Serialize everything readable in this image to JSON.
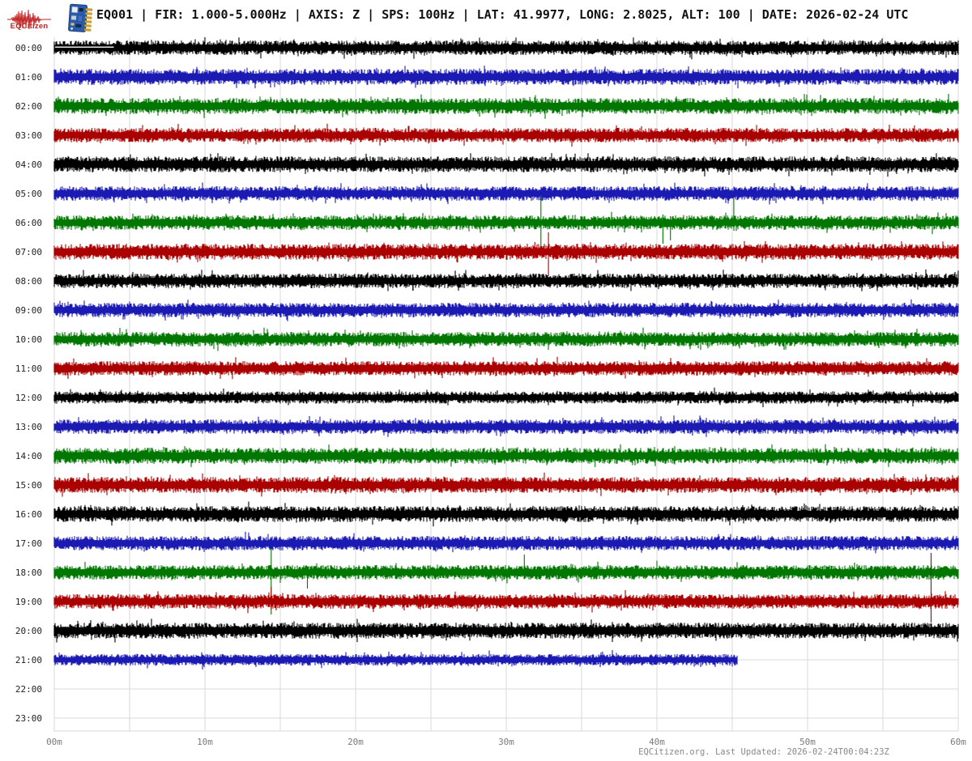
{
  "header": {
    "logo_text": "EQCitizen",
    "title": "EQ001 | FIR: 1.000-5.000Hz | AXIS: Z | SPS: 100Hz | LAT: 41.9977, LONG: 2.8025, ALT: 100 | DATE: 2026-02-24 UTC"
  },
  "colors": {
    "grid": "#d9d9d9",
    "hour_label": "#222222",
    "tick_label": "#7a7a7a",
    "footer_text": "#888888",
    "logo_red": "#c22222",
    "chip_blue": "#2b5cab",
    "chip_blue_dark": "#1c3f7a",
    "chip_gold": "#d9a520",
    "trace_black": "#000000",
    "trace_blue": "#1b1bb3",
    "trace_green": "#007700",
    "trace_red": "#aa0000"
  },
  "chart_data": {
    "type": "helicorder",
    "station": "EQ001",
    "filter_band_hz": [
      1.0,
      5.0
    ],
    "axis": "Z",
    "sample_rate_hz": 100,
    "lat": 41.9977,
    "long": 2.8025,
    "alt": 100,
    "date_utc": "2026-02-24",
    "minutes_per_row": 60,
    "grid_interval_minutes": 5,
    "tick_interval_minutes": 10,
    "x_ticks": [
      "00m",
      "10m",
      "20m",
      "30m",
      "40m",
      "50m",
      "60m"
    ],
    "rows": [
      {
        "hour": "00:00",
        "color": "#000000",
        "amp": 1.0,
        "end_min": 60,
        "spikes": [],
        "flat_line_min": [
          0.05,
          3.95
        ]
      },
      {
        "hour": "01:00",
        "color": "#1b1bb3",
        "amp": 1.1,
        "end_min": 60,
        "spikes": []
      },
      {
        "hour": "02:00",
        "color": "#007700",
        "amp": 1.1,
        "end_min": 60,
        "spikes": []
      },
      {
        "hour": "03:00",
        "color": "#aa0000",
        "amp": 1.0,
        "end_min": 60,
        "spikes": [
          {
            "m": 2.5,
            "up": 9,
            "down": 5
          }
        ]
      },
      {
        "hour": "04:00",
        "color": "#000000",
        "amp": 1.1,
        "end_min": 60,
        "spikes": []
      },
      {
        "hour": "05:00",
        "color": "#1b1bb3",
        "amp": 1.0,
        "end_min": 60,
        "spikes": []
      },
      {
        "hour": "06:00",
        "color": "#007700",
        "amp": 1.0,
        "end_min": 60,
        "spikes": [
          {
            "m": 32.3,
            "up": 34,
            "down": 30
          },
          {
            "m": 40.4,
            "up": 10,
            "down": 26
          },
          {
            "m": 40.9,
            "up": 8,
            "down": 22
          },
          {
            "m": 45.1,
            "up": 30,
            "down": 8
          }
        ]
      },
      {
        "hour": "07:00",
        "color": "#aa0000",
        "amp": 1.1,
        "end_min": 60,
        "spikes": [
          {
            "m": 31.9,
            "up": 12,
            "down": 8
          },
          {
            "m": 32.8,
            "up": 24,
            "down": 30
          }
        ]
      },
      {
        "hour": "08:00",
        "color": "#000000",
        "amp": 1.0,
        "end_min": 60,
        "spikes": [
          {
            "m": 23.8,
            "up": 8,
            "down": 12
          }
        ]
      },
      {
        "hour": "09:00",
        "color": "#1b1bb3",
        "amp": 1.0,
        "end_min": 60,
        "spikes": []
      },
      {
        "hour": "10:00",
        "color": "#007700",
        "amp": 1.0,
        "end_min": 60,
        "spikes": []
      },
      {
        "hour": "11:00",
        "color": "#aa0000",
        "amp": 1.0,
        "end_min": 60,
        "spikes": []
      },
      {
        "hour": "12:00",
        "color": "#000000",
        "amp": 0.85,
        "end_min": 60,
        "spikes": []
      },
      {
        "hour": "13:00",
        "color": "#1b1bb3",
        "amp": 1.0,
        "end_min": 60,
        "spikes": []
      },
      {
        "hour": "14:00",
        "color": "#007700",
        "amp": 1.1,
        "end_min": 60,
        "spikes": [
          {
            "m": 35.9,
            "up": 6,
            "down": 14
          }
        ]
      },
      {
        "hour": "15:00",
        "color": "#aa0000",
        "amp": 1.1,
        "end_min": 60,
        "spikes": []
      },
      {
        "hour": "16:00",
        "color": "#000000",
        "amp": 1.1,
        "end_min": 60,
        "spikes": []
      },
      {
        "hour": "17:00",
        "color": "#1b1bb3",
        "amp": 1.0,
        "end_min": 60,
        "spikes": []
      },
      {
        "hour": "18:00",
        "color": "#007700",
        "amp": 1.0,
        "end_min": 60,
        "spikes": [
          {
            "m": 14.4,
            "up": 30,
            "down": 52
          },
          {
            "m": 16.8,
            "up": 6,
            "down": 20
          },
          {
            "m": 31.2,
            "up": 22,
            "down": 8
          },
          {
            "m": 58.2,
            "up": 12,
            "down": 6
          }
        ]
      },
      {
        "hour": "19:00",
        "color": "#aa0000",
        "amp": 1.0,
        "end_min": 60,
        "spikes": [
          {
            "m": 14.4,
            "up": 18,
            "down": 10
          },
          {
            "m": 58.2,
            "up": 60,
            "down": 26
          }
        ]
      },
      {
        "hour": "20:00",
        "color": "#000000",
        "amp": 1.1,
        "end_min": 60,
        "spikes": []
      },
      {
        "hour": "21:00",
        "color": "#1b1bb3",
        "amp": 0.8,
        "end_min": 45.3,
        "spikes": []
      },
      {
        "hour": "22:00",
        "color": "#007700",
        "amp": 0,
        "end_min": 0,
        "spikes": []
      },
      {
        "hour": "23:00",
        "color": "#aa0000",
        "amp": 0,
        "end_min": 0,
        "spikes": []
      }
    ]
  },
  "footer": {
    "text": "EQCitizen.org. Last Updated: 2026-02-24T00:04:23Z"
  }
}
